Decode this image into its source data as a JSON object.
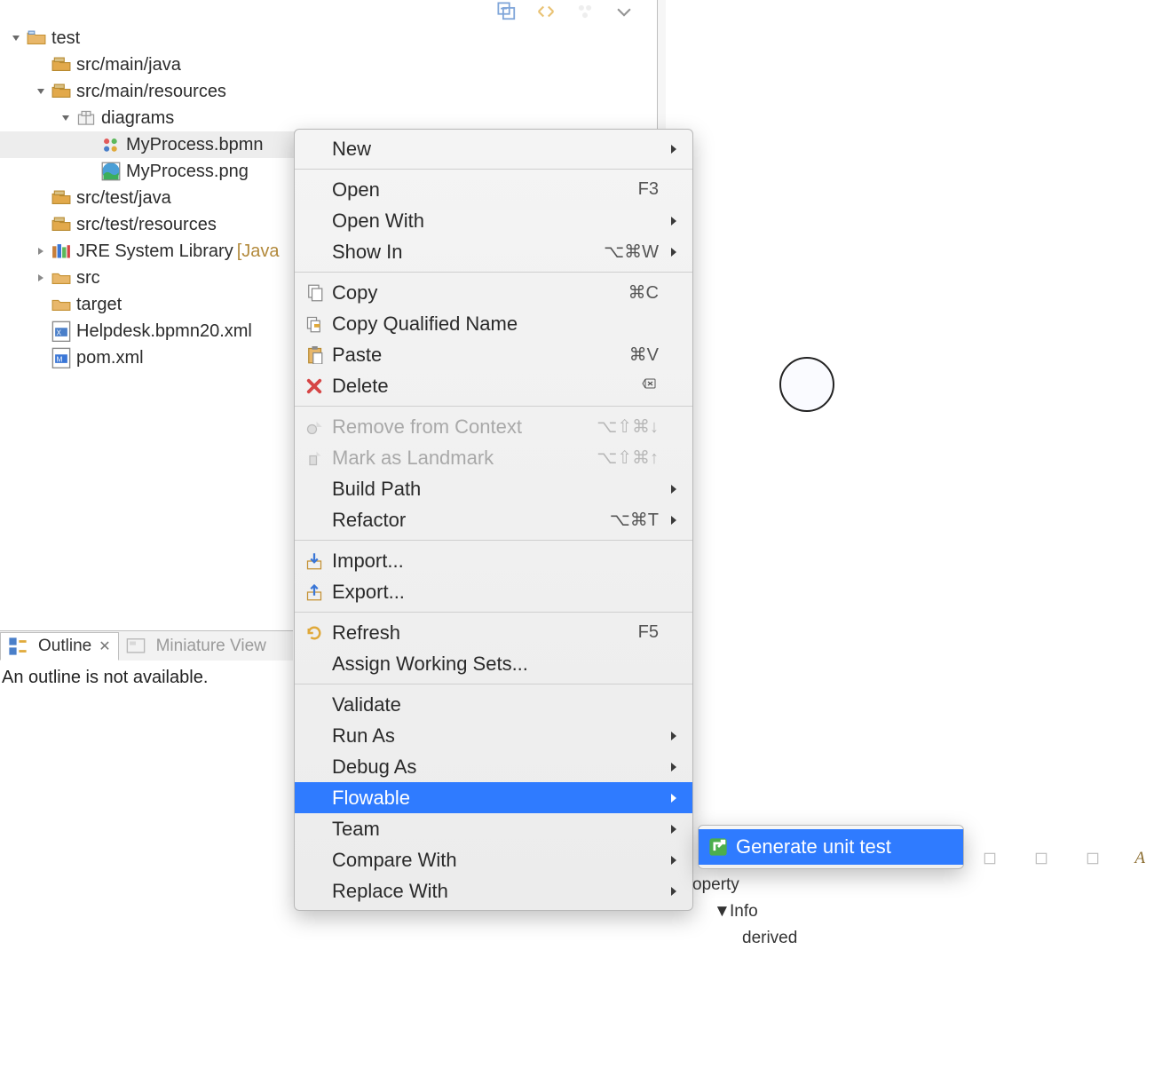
{
  "tree": {
    "root_label": "test",
    "root_expanded": true,
    "items": [
      {
        "id": "src-main-java",
        "label": "src/main/java",
        "indent": 1,
        "icon": "package-folder",
        "twisty": "none"
      },
      {
        "id": "src-main-resources",
        "label": "src/main/resources",
        "indent": 1,
        "icon": "package-folder",
        "twisty": "open"
      },
      {
        "id": "diagrams",
        "label": "diagrams",
        "indent": 2,
        "icon": "package",
        "twisty": "open"
      },
      {
        "id": "myprocess-bpmn",
        "label": "MyProcess.bpmn",
        "indent": 3,
        "icon": "bpmn-file",
        "twisty": "none",
        "selected": true
      },
      {
        "id": "myprocess-png",
        "label": "MyProcess.png",
        "indent": 3,
        "icon": "image-file",
        "twisty": "none"
      },
      {
        "id": "src-test-java",
        "label": "src/test/java",
        "indent": 1,
        "icon": "package-folder",
        "twisty": "none"
      },
      {
        "id": "src-test-resources",
        "label": "src/test/resources",
        "indent": 1,
        "icon": "package-folder",
        "twisty": "none"
      },
      {
        "id": "jre",
        "label": "JRE System Library",
        "decorator": "[Java",
        "indent": 1,
        "icon": "library",
        "twisty": "closed"
      },
      {
        "id": "src",
        "label": "src",
        "indent": 1,
        "icon": "folder",
        "twisty": "closed"
      },
      {
        "id": "target",
        "label": "target",
        "indent": 1,
        "icon": "folder",
        "twisty": "none"
      },
      {
        "id": "helpdesk",
        "label": "Helpdesk.bpmn20.xml",
        "indent": 1,
        "icon": "xml-file",
        "twisty": "none"
      },
      {
        "id": "pom",
        "label": "pom.xml",
        "indent": 1,
        "icon": "maven-file",
        "twisty": "none"
      }
    ]
  },
  "outline": {
    "tab1_label": "Outline",
    "tab2_label": "Miniature View",
    "message": "An outline is not available."
  },
  "context_menu": {
    "sections": [
      [
        {
          "id": "new",
          "label": "New",
          "submenu": true
        }
      ],
      [
        {
          "id": "open",
          "label": "Open",
          "shortcut": "F3"
        },
        {
          "id": "open-with",
          "label": "Open With",
          "submenu": true
        },
        {
          "id": "show-in",
          "label": "Show In",
          "shortcut": "⌥⌘W",
          "submenu": true
        }
      ],
      [
        {
          "id": "copy",
          "label": "Copy",
          "shortcut": "⌘C",
          "icon": "copy"
        },
        {
          "id": "copy-qualified",
          "label": "Copy Qualified Name",
          "icon": "copy-qual"
        },
        {
          "id": "paste",
          "label": "Paste",
          "shortcut": "⌘V",
          "icon": "paste"
        },
        {
          "id": "delete",
          "label": "Delete",
          "shortcut": "⌫",
          "icon": "delete"
        }
      ],
      [
        {
          "id": "remove-context",
          "label": "Remove from Context",
          "shortcut": "⌥⇧⌘↓",
          "icon": "remove-ctx",
          "disabled": true
        },
        {
          "id": "mark-landmark",
          "label": "Mark as Landmark",
          "shortcut": "⌥⇧⌘↑",
          "icon": "landmark",
          "disabled": true
        },
        {
          "id": "build-path",
          "label": "Build Path",
          "submenu": true
        },
        {
          "id": "refactor",
          "label": "Refactor",
          "shortcut": "⌥⌘T",
          "submenu": true
        }
      ],
      [
        {
          "id": "import",
          "label": "Import...",
          "icon": "import"
        },
        {
          "id": "export",
          "label": "Export...",
          "icon": "export"
        }
      ],
      [
        {
          "id": "refresh",
          "label": "Refresh",
          "shortcut": "F5",
          "icon": "refresh"
        },
        {
          "id": "assign-ws",
          "label": "Assign Working Sets..."
        }
      ],
      [
        {
          "id": "validate",
          "label": "Validate"
        },
        {
          "id": "run-as",
          "label": "Run As",
          "submenu": true
        },
        {
          "id": "debug-as",
          "label": "Debug As",
          "submenu": true
        },
        {
          "id": "flowable",
          "label": "Flowable",
          "submenu": true,
          "selected": true
        },
        {
          "id": "team",
          "label": "Team",
          "submenu": true
        },
        {
          "id": "compare-with",
          "label": "Compare With",
          "submenu": true
        },
        {
          "id": "replace-with",
          "label": "Replace With",
          "submenu": true
        }
      ]
    ]
  },
  "submenu": {
    "items": [
      {
        "id": "gen-unit-test",
        "label": "Generate unit test",
        "icon": "flowable",
        "selected": true
      }
    ]
  },
  "props": {
    "row1": "operty",
    "row2": "Info",
    "row3": "derived",
    "toolbar_a": "A"
  }
}
